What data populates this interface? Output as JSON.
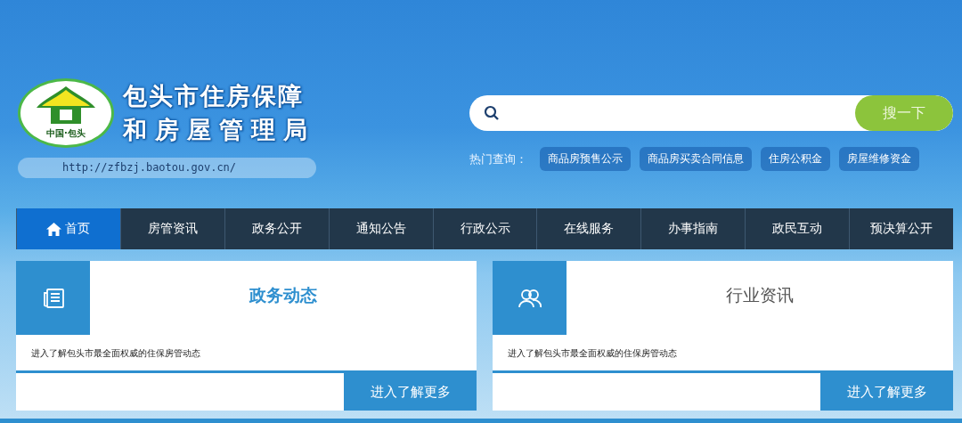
{
  "header": {
    "logo_caption": "中国·包头",
    "title_lines": [
      "包头市住房保障",
      "和房屋管理局"
    ],
    "url": "http://zfbzj.baotou.gov.cn/"
  },
  "search": {
    "button": "搜一下"
  },
  "hot_queries": {
    "label": "热门查询：",
    "items": [
      "商品房预售公示",
      "商品房买卖合同信息",
      "住房公积金",
      "房屋维修资金"
    ]
  },
  "nav": [
    {
      "label": "首页",
      "selected": true
    },
    {
      "label": "房管资讯",
      "selected": false
    },
    {
      "label": "政务公开",
      "selected": false
    },
    {
      "label": "通知公告",
      "selected": false
    },
    {
      "label": "行政公示",
      "selected": false
    },
    {
      "label": "在线服务",
      "selected": false
    },
    {
      "label": "办事指南",
      "selected": false
    },
    {
      "label": "政民互动",
      "selected": false
    },
    {
      "label": "预决算公开",
      "selected": false
    }
  ],
  "cards": [
    {
      "kind": "news",
      "title": "政务动态",
      "highlighted": true,
      "description": "进入了解包头市最全面权威的住保房管动态",
      "button": "进入了解更多"
    },
    {
      "kind": "people",
      "title": "行业资讯",
      "highlighted": false,
      "description": "进入了解包头市最全面权威的住保房管动态",
      "button": "进入了解更多"
    }
  ]
}
